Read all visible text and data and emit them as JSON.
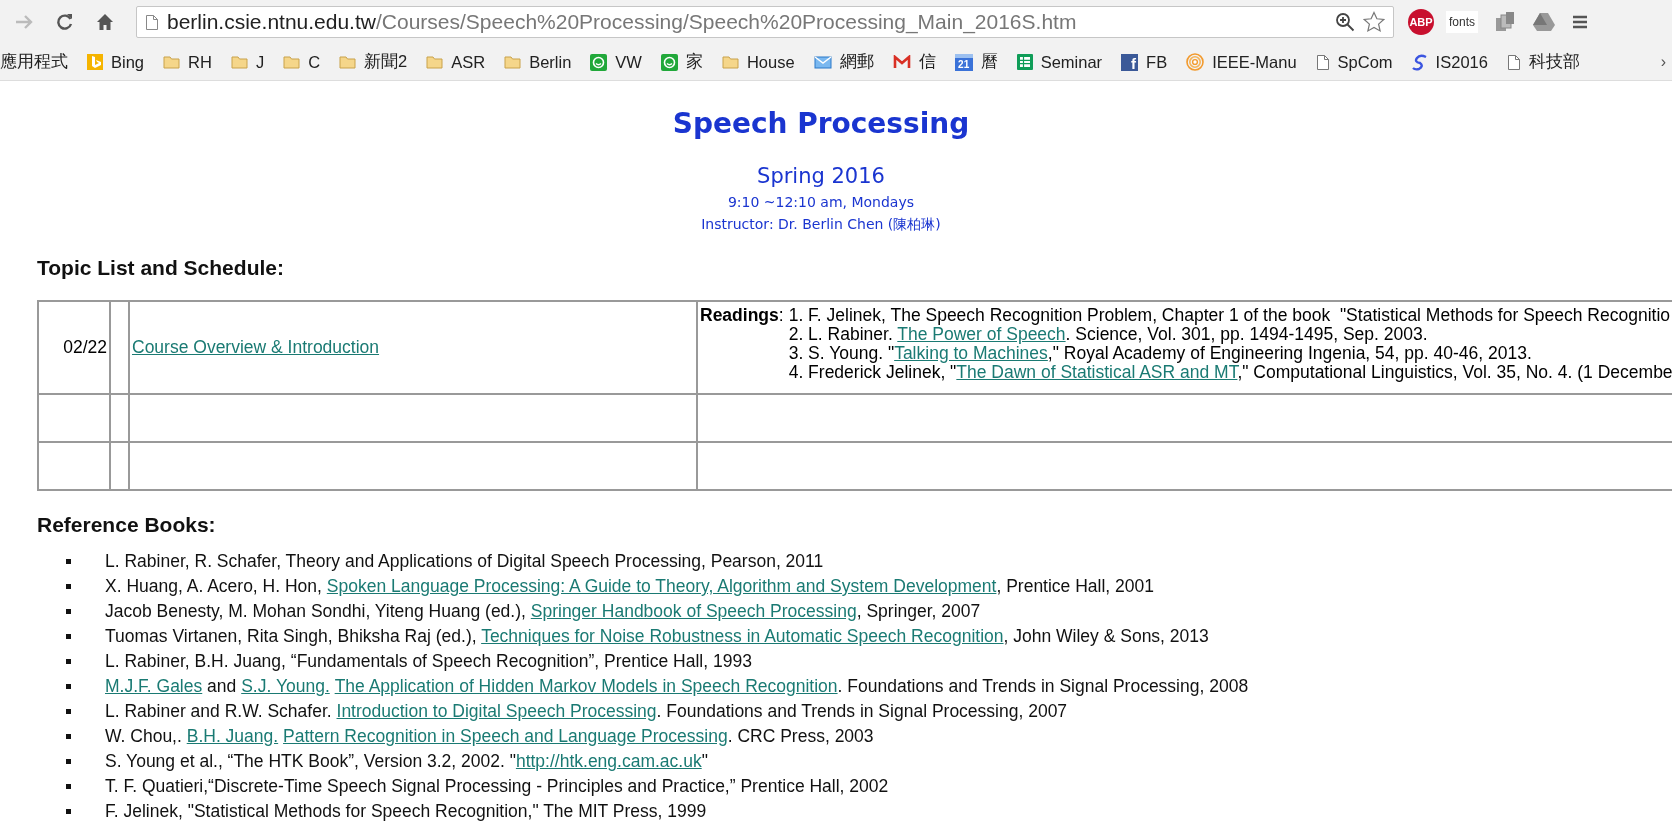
{
  "browser": {
    "url_host": "berlin.csie.ntnu.edu.tw",
    "url_path": "/Courses/Speech%20Processing/Speech%20Processing_Main_2016S.htm",
    "back_disabled": true,
    "starred": false,
    "abp_label": "ABP",
    "fonts_label": "fonts"
  },
  "bookmarks": [
    {
      "label": "應用程式",
      "kind": "text"
    },
    {
      "label": "Bing",
      "kind": "bing"
    },
    {
      "label": "RH",
      "kind": "folder"
    },
    {
      "label": "J",
      "kind": "folder"
    },
    {
      "label": "C",
      "kind": "folder"
    },
    {
      "label": "新聞2",
      "kind": "folder"
    },
    {
      "label": "ASR",
      "kind": "folder"
    },
    {
      "label": "Berlin",
      "kind": "folder"
    },
    {
      "label": "VW",
      "kind": "app"
    },
    {
      "label": "家",
      "kind": "app"
    },
    {
      "label": "House",
      "kind": "folder"
    },
    {
      "label": "網郵",
      "kind": "mail"
    },
    {
      "label": "信",
      "kind": "gmail"
    },
    {
      "label": "曆",
      "kind": "calendar",
      "icon_text": "21"
    },
    {
      "label": "Seminar",
      "kind": "sheet"
    },
    {
      "label": "FB",
      "kind": "facebook",
      "icon_text": "f"
    },
    {
      "label": "IEEE-Manu",
      "kind": "ieee"
    },
    {
      "label": "SpCom",
      "kind": "page"
    },
    {
      "label": "IS2016",
      "kind": "s"
    },
    {
      "label": "科技部",
      "kind": "page"
    }
  ],
  "bookmarks_more": "›",
  "header": {
    "title": "Speech Processing",
    "term": "Spring 2016",
    "time": "9:10 ~12:10 am, Mondays",
    "instructor": "Instructor: Dr. Berlin Chen (陳柏琳)"
  },
  "schedule": {
    "heading": "Topic List and Schedule:",
    "rows": [
      {
        "date": "02/22",
        "topic": "Course Overview & Introduction",
        "readings_label": "**Readings**:",
        "readings": [
          [
            {
              "text": "1. F. Jelinek, The Speech Recognition Problem, Chapter 1 of the book  \"Statistical Methods for Speech Recognitio",
              "kind": "text"
            }
          ],
          [
            {
              "text": "2. L. Rabiner. ",
              "kind": "text"
            },
            {
              "text": "The Power of Speech",
              "kind": "link"
            },
            {
              "text": ". Science, Vol. 301, pp. 1494-1495, Sep. 2003.",
              "kind": "text"
            }
          ],
          [
            {
              "text": "3. S. Young. \"",
              "kind": "text"
            },
            {
              "text": "Talking to Machines",
              "kind": "link"
            },
            {
              "text": ",\" Royal Academy of Engineering Ingenia, 54, pp. 40-46, 2013.",
              "kind": "text"
            }
          ],
          [
            {
              "text": "4. Frederick Jelinek, \"",
              "kind": "text"
            },
            {
              "text": "The Dawn of Statistical ASR and MT",
              "kind": "link"
            },
            {
              "text": ",\" Computational Linguistics, Vol. 35, No. 4. (1 Decembe",
              "kind": "text"
            }
          ]
        ]
      },
      {},
      {}
    ]
  },
  "references": {
    "heading": "Reference Books:",
    "items": [
      [
        {
          "text": "L. Rabiner, R. Schafer, Theory and Applications of Digital Speech Processing, Pearson, 2011",
          "kind": "text"
        }
      ],
      [
        {
          "text": "X. Huang, A. Acero, H. Hon, ",
          "kind": "text"
        },
        {
          "text": "Spoken Language Processing: A Guide to Theory, Algorithm and System Development",
          "kind": "link"
        },
        {
          "text": ", Prentice Hall, 2001",
          "kind": "text"
        }
      ],
      [
        {
          "text": "Jacob Benesty, M. Mohan Sondhi, Yiteng Huang (ed.), ",
          "kind": "text"
        },
        {
          "text": "Springer Handbook of Speech Processing",
          "kind": "link"
        },
        {
          "text": ", Springer, 2007",
          "kind": "text"
        }
      ],
      [
        {
          "text": "Tuomas Virtanen, Rita Singh, Bhiksha Raj (ed.), ",
          "kind": "text"
        },
        {
          "text": "Techniques for Noise Robustness in Automatic Speech Recognition",
          "kind": "link"
        },
        {
          "text": ", John Wiley & Sons, 2013",
          "kind": "text"
        }
      ],
      [
        {
          "text": "L. Rabiner, B.H. Juang, “Fundamentals of Speech Recognition”, Prentice Hall, 1993",
          "kind": "text"
        }
      ],
      [
        {
          "text": "M.J.F. Gales",
          "kind": "link"
        },
        {
          "text": " and ",
          "kind": "text"
        },
        {
          "text": "S.J. Young.",
          "kind": "link"
        },
        {
          "text": "The Application of Hidden Markov Models in Speech Recognition",
          "kind": "link"
        },
        {
          "text": ". Foundations and Trends in Signal Processing, 2008",
          "kind": "text"
        }
      ],
      [
        {
          "text": "L. Rabiner and R.W. Schafer. ",
          "kind": "text"
        },
        {
          "text": "Introduction to Digital Speech Processing",
          "kind": "link"
        },
        {
          "text": ". Foundations and Trends in Signal Processing, 2007",
          "kind": "text"
        }
      ],
      [
        {
          "text": "W. Chou,. ",
          "kind": "text"
        },
        {
          "text": "B.H. Juang.",
          "kind": "link"
        },
        {
          "text": "Pattern Recognition in Speech and Language Processing",
          "kind": "link"
        },
        {
          "text": ". CRC Press, 2003",
          "kind": "text"
        }
      ],
      [
        {
          "text": "S. Young et al., “The HTK Book”, Version 3.2, 2002. \"",
          "kind": "text"
        },
        {
          "text": "http://htk.eng.cam.ac.uk",
          "kind": "link"
        },
        {
          "text": "\"",
          "kind": "text"
        }
      ],
      [
        {
          "text": "T. F. Quatieri,“Discrete-Time Speech Signal Processing - Principles and Practice,” Prentice Hall, 2002",
          "kind": "text"
        }
      ],
      [
        {
          "text": "F. Jelinek, \"Statistical Methods for Speech Recognition,\" The MIT Press, 1999",
          "kind": "text"
        }
      ]
    ]
  }
}
